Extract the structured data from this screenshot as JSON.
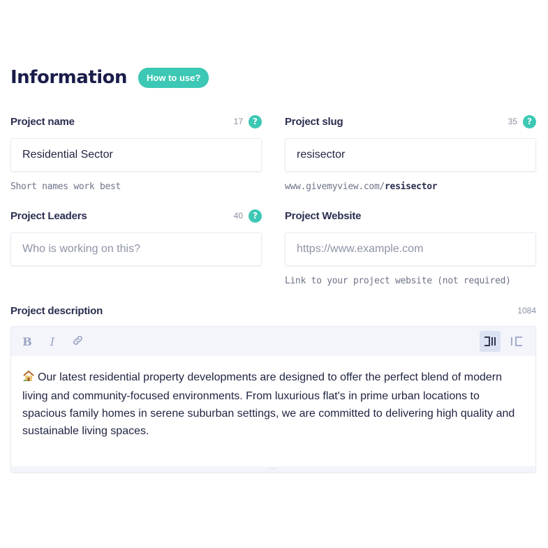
{
  "header": {
    "title": "Information",
    "help_button": "How to use?"
  },
  "fields": {
    "project_name": {
      "label": "Project name",
      "count": "17",
      "value": "Residential Sector",
      "hint": "Short names work best"
    },
    "project_slug": {
      "label": "Project slug",
      "count": "35",
      "value": "resisector",
      "hint_prefix": "www.givemyview.com/",
      "hint_slug": "resisector"
    },
    "project_leaders": {
      "label": "Project Leaders",
      "count": "40",
      "placeholder": "Who is working on this?"
    },
    "project_website": {
      "label": "Project Website",
      "placeholder": "https://www.example.com",
      "hint": "Link to your project website (not required)"
    }
  },
  "description": {
    "label": "Project description",
    "count": "1084",
    "toolbar": {
      "bold": "B",
      "italic": "I",
      "icons": [
        "link-icon",
        "ltr-icon",
        "rtl-icon"
      ]
    },
    "body": "Our latest residential property developments are designed to offer the perfect blend of modern living and community-focused environments. From luxurious flat's in prime urban locations to spacious family homes in serene suburban settings, we are committed to delivering high quality and sustainable living spaces.",
    "resize_handle": "···"
  },
  "colors": {
    "accent": "#3cc8b4",
    "title": "#1a1d4a",
    "toolbar_bg": "#f3f5fb"
  }
}
